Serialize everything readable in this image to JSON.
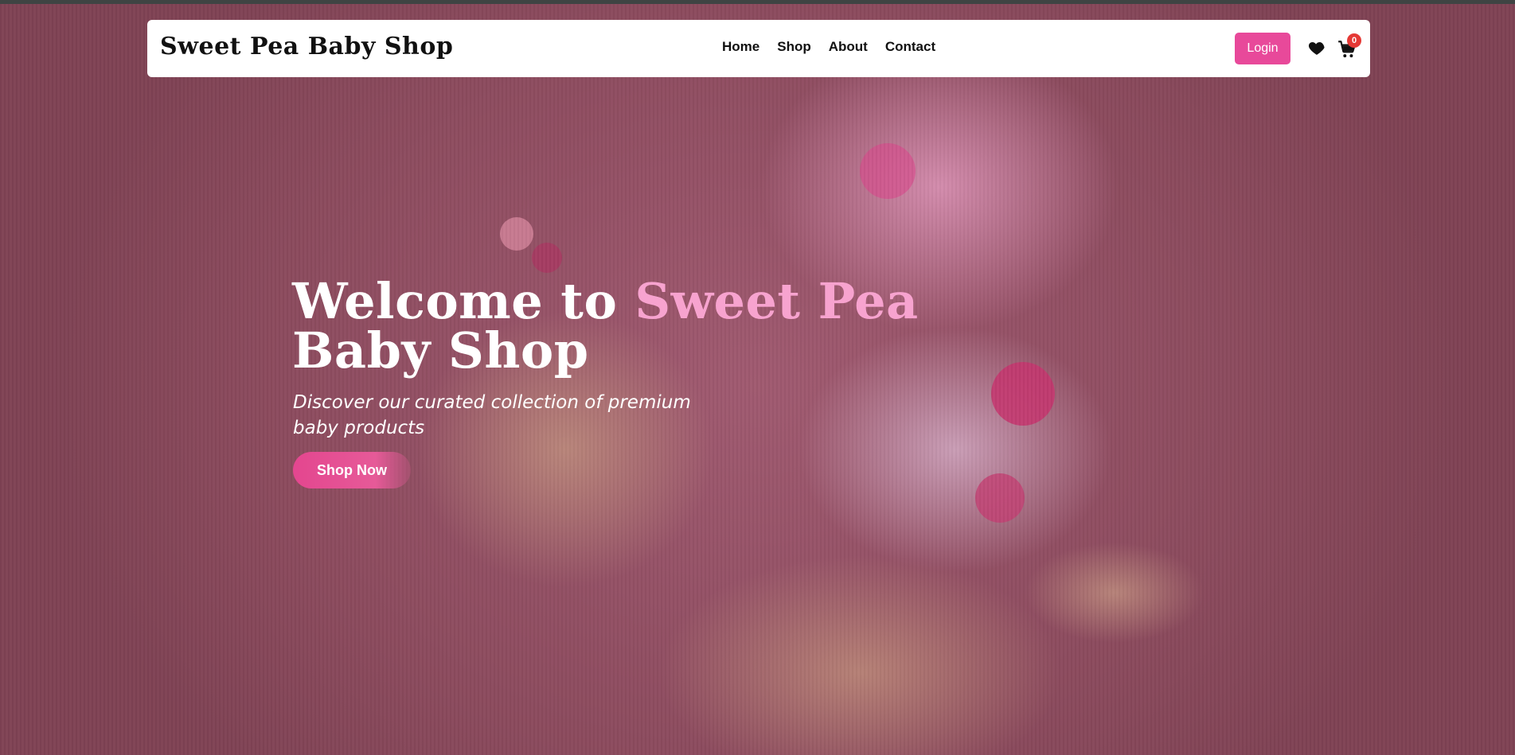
{
  "brand": {
    "name": "Sweet Pea Baby Shop"
  },
  "nav": {
    "links": [
      {
        "label": "Home"
      },
      {
        "label": "Shop"
      },
      {
        "label": "About"
      },
      {
        "label": "Contact"
      }
    ]
  },
  "actions": {
    "login_label": "Login",
    "wishlist_icon": "heart-icon",
    "cart_icon": "shopping-cart-icon",
    "cart_count": "0"
  },
  "hero": {
    "title_prefix": "Welcome to ",
    "title_accent": "Sweet Pea",
    "title_suffix": "Baby Shop",
    "subtitle": "Discover our curated collection of premium baby products",
    "cta_label": "Shop Now"
  },
  "colors": {
    "accent": "#e8499a",
    "title_accent": "#f7a3cf",
    "badge": "#e53935"
  }
}
